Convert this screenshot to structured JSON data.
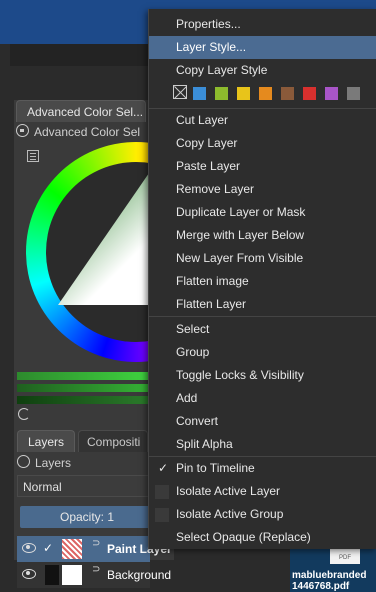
{
  "left_panel": {
    "color_tab": "Advanced Color Sel...",
    "color_header": "Advanced Color Sel",
    "layers_tab": "Layers",
    "composition_tab": "Compositi",
    "layers_header": "Layers",
    "blend_mode": "Normal",
    "opacity_label": "Opacity:  1",
    "layers": [
      {
        "name": "Paint Layer",
        "selected": true
      },
      {
        "name": "Background",
        "selected": false
      }
    ]
  },
  "desktop": {
    "file_icon_text": "PDF",
    "file_name_line1": "mabluebranded",
    "file_name_line2": "1446768.pdf"
  },
  "menu": {
    "items": [
      {
        "label": "Properties...",
        "highlight": false
      },
      {
        "label": "Layer Style...",
        "highlight": true
      },
      {
        "label": "Copy Layer Style",
        "highlight": false
      },
      {
        "label": "Cut Layer",
        "highlight": false
      },
      {
        "label": "Copy Layer",
        "highlight": false
      },
      {
        "label": "Paste Layer",
        "highlight": false
      },
      {
        "label": "Remove Layer",
        "highlight": false
      },
      {
        "label": "Duplicate Layer or Mask",
        "highlight": false
      },
      {
        "label": "Merge with Layer Below",
        "highlight": false
      },
      {
        "label": "New Layer From Visible",
        "highlight": false
      },
      {
        "label": "Flatten image",
        "highlight": false
      },
      {
        "label": "Flatten Layer",
        "highlight": false
      },
      {
        "label": "Select",
        "highlight": false
      },
      {
        "label": "Group",
        "highlight": false
      },
      {
        "label": "Toggle Locks & Visibility",
        "highlight": false
      },
      {
        "label": "Add",
        "highlight": false
      },
      {
        "label": "Convert",
        "highlight": false
      },
      {
        "label": "Split Alpha",
        "highlight": false
      },
      {
        "label": "Pin to Timeline",
        "checked": true
      },
      {
        "label": "Isolate Active Layer",
        "checked": false
      },
      {
        "label": "Isolate Active Group",
        "checked": false
      },
      {
        "label": "Select Opaque (Replace)",
        "highlight": false
      }
    ],
    "color_labels": [
      "#3b8ed8",
      "#8dbb2d",
      "#e8c41a",
      "#e58a1e",
      "#8a5a3a",
      "#d8302e",
      "#a855c8",
      "#7a7a7a"
    ]
  }
}
